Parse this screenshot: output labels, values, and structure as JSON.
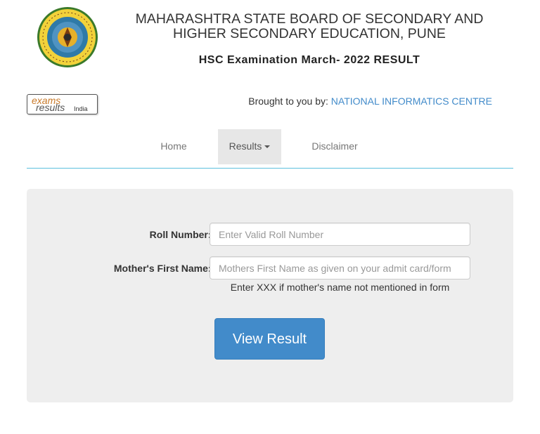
{
  "header": {
    "board_title": "MAHARASHTRA STATE BOARD OF SECONDARY AND HIGHER SECONDARY EDUCATION, PUNE",
    "exam_title": "HSC Examination March- 2022 RESULT"
  },
  "partner": {
    "logo_exams": "exams",
    "logo_results": "results",
    "logo_india": "India",
    "brought_prefix": "Brought to you by: ",
    "brought_org": "NATIONAL INFORMATICS CENTRE"
  },
  "nav": {
    "home": "Home",
    "results": "Results",
    "disclaimer": "Disclaimer"
  },
  "form": {
    "roll_label": "Roll Number:*",
    "roll_placeholder": "Enter Valid Roll Number",
    "mother_label": "Mother's First Name:*",
    "mother_placeholder": "Mothers First Name as given on your admit card/form",
    "mother_hint": "Enter XXX if mother's name not mentioned in form",
    "submit_label": "View Result"
  },
  "colors": {
    "accent": "#428bca",
    "nav_border": "#5bc0de",
    "panel_bg": "#eeeeee"
  }
}
